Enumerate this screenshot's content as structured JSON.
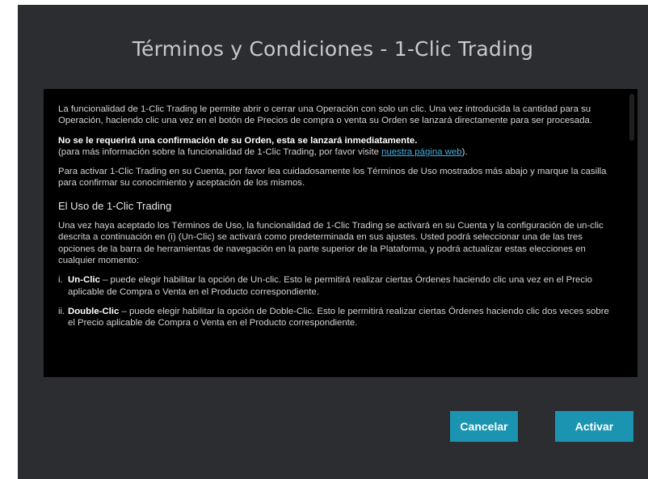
{
  "dialog": {
    "title": "Términos y Condiciones - 1-Clic Trading",
    "cancel_label": "Cancelar",
    "activate_label": "Activar"
  },
  "terms": {
    "p1": "La funcionalidad de 1-Clic Trading le permite abrir o cerrar una Operación con solo un clic. Una vez introducida la cantidad para su Operación, haciendo clic una vez en el botón de Precios de compra o venta su Orden se lanzará directamente para ser procesada.",
    "warning": "No se le requerirá una confirmación de su Orden, esta se lanzará inmediatamente.",
    "info_prefix": "(para más información sobre la funcionalidad de 1-Clic Trading, por favor visite ",
    "info_link": "nuestra página web",
    "info_suffix": ").",
    "p3": "Para activar 1-Clic Trading en su Cuenta, por favor lea cuidadosamente los Términos de Uso mostrados más abajo y marque la casilla para confirmar su conocimiento y aceptación de los mismos.",
    "section_title": "El Uso de 1-Clic Trading",
    "p4": "Una vez haya aceptado los Términos de Uso, la funcionalidad de 1-Clic Trading se activará en su Cuenta y la configuración de un-clic descrita a continuación en (i) (Un-Clic) se activará como predeterminada en sus ajustes. Usted podrá seleccionar una de las tres opciones de la barra de herramientas de navegación en la parte superior de la Plataforma, y podrá actualizar estas elecciones en cualquier momento:",
    "items": [
      {
        "num": "i.",
        "name": "Un-Clic",
        "text": " – puede elegir habilitar la opción de Un-clic. Esto le permitirá realizar ciertas Órdenes haciendo clic una vez en el Precio aplicable de Compra o Venta en el Producto correspondiente."
      },
      {
        "num": "ii.",
        "name": "Double-Clic",
        "text": " – puede elegir habilitar la opción de Doble-Clic. Esto le permitirá realizar ciertas Órdenes haciendo clic dos veces sobre el Precio aplicable de Compra o Venta en el Producto correspondiente."
      }
    ]
  },
  "colors": {
    "dialog_bg": "#2b2d30",
    "terms_bg": "#000000",
    "button_bg": "#1a94b0",
    "link": "#3fb2e0"
  }
}
